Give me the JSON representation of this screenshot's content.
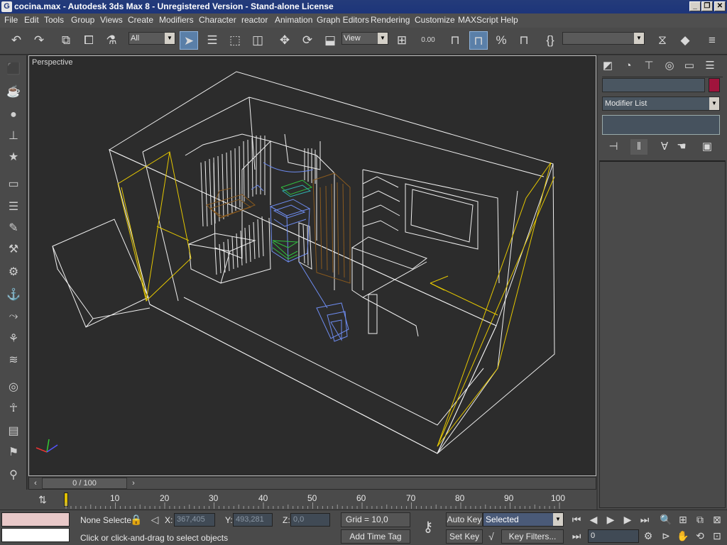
{
  "window": {
    "title": "cocina.max - Autodesk 3ds Max 8  - Unregistered Version - Stand-alone License",
    "app_icon": "3ds-max-logo-icon",
    "buttons": [
      "minimize",
      "restore",
      "close"
    ]
  },
  "menu": [
    "File",
    "Edit",
    "Tools",
    "Group",
    "Views",
    "Create",
    "Modifiers",
    "Character",
    "reactor",
    "Animation",
    "Graph Editors",
    "Rendering",
    "Customize",
    "MAXScript",
    "Help"
  ],
  "toolbar": {
    "selection_filter": "All",
    "reference_coord": "View",
    "spinner_snap_value": "0.00",
    "named_selection_set": ""
  },
  "viewport": {
    "label": "Perspective"
  },
  "command_panel": {
    "object_name": "",
    "object_color": "#a0143c",
    "modifier_list": "Modifier List"
  },
  "time_slider": {
    "frame_display": "0 / 100",
    "current_frame": 0,
    "ticks": [
      "10",
      "20",
      "30",
      "40",
      "50",
      "60",
      "70",
      "80",
      "90",
      "100"
    ]
  },
  "status": {
    "selection": "None Selecte",
    "x_label": "X:",
    "x_value": "367,405",
    "y_label": "Y:",
    "y_value": "493,281",
    "z_label": "Z:",
    "z_value": "0,0",
    "grid": "Grid = 10,0",
    "prompt": "Click or click-and-drag to select objects",
    "add_time_tag": "Add Time Tag",
    "auto_key": "Auto Key",
    "set_key": "Set Key",
    "key_mode": "Selected",
    "key_filters": "Key Filters...",
    "frame_field": "0"
  },
  "colors": {
    "wireframe_white": "#f0f0f0",
    "wireframe_yellow": "#e6c800",
    "wireframe_brown": "#8a5a1e",
    "wireframe_blue": "#6e8cf0",
    "wireframe_green": "#30c040",
    "wireframe_cyan": "#30b0b0"
  }
}
